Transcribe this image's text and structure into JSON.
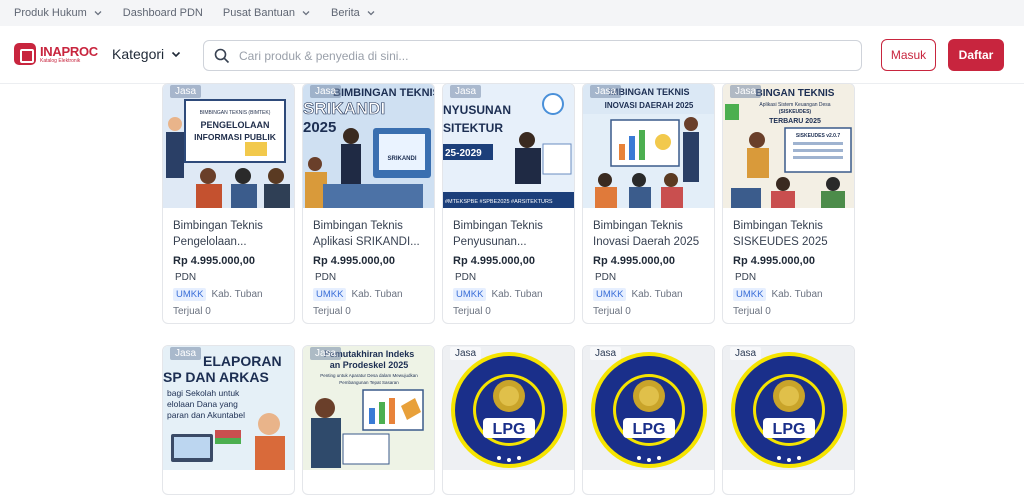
{
  "topbar": {
    "links": [
      "Produk Hukum",
      "Dashboard PDN",
      "Pusat Bantuan",
      "Berita"
    ]
  },
  "header": {
    "logo_main": "INAPROC",
    "logo_sub": "Katalog Elektronik",
    "kategori_label": "Kategori",
    "search_placeholder": "Cari produk & penyedia di sini...",
    "login_label": "Masuk",
    "register_label": "Daftar"
  },
  "colors": {
    "brand": "#c8253e",
    "umkk_bg": "#e6efff",
    "umkk_text": "#3b6fd8"
  },
  "products": [
    {
      "tag": "Jasa",
      "thumb_text": [
        "BIMBINGAN TEKNIS (BIMTEK)",
        "PENGELOLAAN",
        "INFORMASI PUBLIK"
      ],
      "title": "Bimbingan Teknis Pengelolaan...",
      "price": "Rp 4.995.000,00",
      "pdn": "PDN",
      "badge": "UMKK",
      "location": "Kab. Tuban",
      "sold": "Terjual 0"
    },
    {
      "tag": "Jasa",
      "thumb_text": [
        "BIMBINGAN TEKNIS",
        "SRIKANDI",
        "2025",
        "SRIKANDI"
      ],
      "title": "Bimbingan Teknis Aplikasi SRIKANDI...",
      "price": "Rp 4.995.000,00",
      "pdn": "PDN",
      "badge": "UMKK",
      "location": "Kab. Tuban",
      "sold": "Terjual 0"
    },
    {
      "tag": "Jasa",
      "thumb_text": [
        "NYUSUNAN",
        "SITEKTUR",
        "25-2029",
        "#MTEKSPBE #SPBE2025 #ARSITEKTURS"
      ],
      "title": "Bimbingan Teknis Penyusunan...",
      "price": "Rp 4.995.000,00",
      "pdn": "PDN",
      "badge": "UMKK",
      "location": "Kab. Tuban",
      "sold": "Terjual 0"
    },
    {
      "tag": "Jasa",
      "thumb_text": [
        "IMBINGAN TEKNIS",
        "INOVASI DAERAH 2025"
      ],
      "title": "Bimbingan Teknis Inovasi Daerah 2025",
      "price": "Rp 4.995.000,00",
      "pdn": "PDN",
      "badge": "UMKK",
      "location": "Kab. Tuban",
      "sold": "Terjual 0"
    },
    {
      "tag": "Jasa",
      "thumb_text": [
        "BINGAN TEKNIS",
        "Aplikasi Sistem Keuangan Desa",
        "(SISKEUDES)",
        "TERBARU 2025",
        "SISKEUDES v2.0.7"
      ],
      "title": "Bimbingan Teknis SISKEUDES 2025",
      "price": "Rp 4.995.000,00",
      "pdn": "PDN",
      "badge": "UMKK",
      "location": "Kab. Tuban",
      "sold": "Terjual 0"
    },
    {
      "tag": "Jasa",
      "thumb_text": [
        "ELAPORAN",
        "SP DAN ARKAS",
        "bagi Sekolah untuk",
        "elolaan Dana yang",
        "paran dan Akuntabel"
      ]
    },
    {
      "tag": "Jasa",
      "thumb_text": [
        "Pemutakhiran Indeks",
        "an Prodeskel 2025",
        "Penting untuk Aparatur Desa dalam Mewujudkan",
        "Pembangunan Tepat Sasaran"
      ]
    },
    {
      "tag": "Jasa",
      "thumb_text": [
        "LPG"
      ]
    },
    {
      "tag": "Jasa",
      "thumb_text": [
        "LPG"
      ]
    },
    {
      "tag": "Jasa",
      "thumb_text": [
        "LPG"
      ]
    }
  ]
}
